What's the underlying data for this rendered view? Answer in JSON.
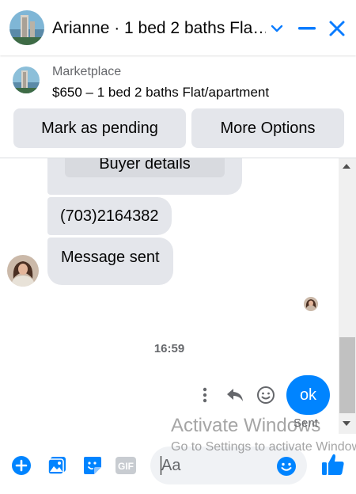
{
  "header": {
    "title": "Arianne · 1 bed 2 baths Fla…",
    "chevron_icon": "chevron-down-icon",
    "minimize_icon": "minimize-icon",
    "close_icon": "close-icon"
  },
  "listing": {
    "kicker": "Marketplace",
    "title": "$650 – 1 bed 2 baths Flat/apartment"
  },
  "actions": {
    "mark_pending": "Mark as pending",
    "more_options": "More Options"
  },
  "messages": {
    "card_button": "Buyer details",
    "phone": "(703)2164382",
    "sent_note": "Message sent",
    "timestamp": "16:59",
    "outgoing": "ok",
    "status": "Sent"
  },
  "watermark": {
    "line1": "Activate Windows",
    "line2": "Go to Settings to activate Windows."
  },
  "composer": {
    "placeholder": "Aa",
    "icons": [
      "plus-icon",
      "photo-icon",
      "sticker-icon",
      "gif-icon",
      "emoji-icon",
      "thumbs-up-icon"
    ]
  },
  "colors": {
    "accent": "#0084ff",
    "bubble_gray": "#e4e6eb",
    "close": "#0a7cff"
  }
}
